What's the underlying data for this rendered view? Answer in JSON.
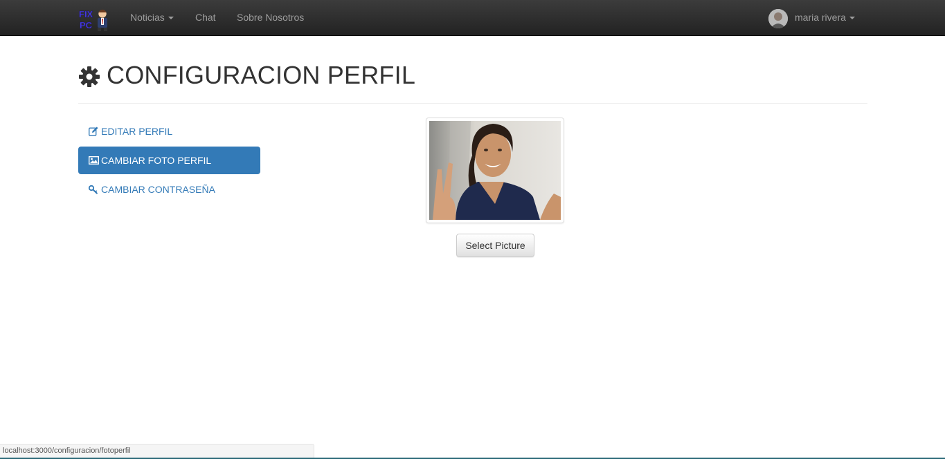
{
  "navbar": {
    "brand": {
      "logo_text_top": "FIX",
      "logo_text_bottom": "PC",
      "icon": "fixpc-logo-icon"
    },
    "items": [
      {
        "label": "Noticias",
        "has_dropdown": true
      },
      {
        "label": "Chat",
        "has_dropdown": false
      },
      {
        "label": "Sobre Nosotros",
        "has_dropdown": false
      }
    ],
    "user": {
      "name": "maria rivera",
      "has_dropdown": true,
      "avatar_icon": "user-avatar"
    }
  },
  "page": {
    "title": "CONFIGURACION PERFIL",
    "title_icon": "gear-icon"
  },
  "sidebar": {
    "items": [
      {
        "label": "EDITAR PERFIL",
        "icon": "edit-icon",
        "active": false
      },
      {
        "label": "CAMBIAR FOTO PERFIL",
        "icon": "picture-icon",
        "active": true
      },
      {
        "label": "CAMBIAR CONTRASEÑA",
        "icon": "key-icon",
        "active": false
      }
    ]
  },
  "profile_photo": {
    "button_label": "Select Picture"
  },
  "status_bar": {
    "url": "localhost:3000/configuracion/fotoperfil"
  },
  "colors": {
    "navbar_bg": "#222222",
    "nav_text": "#9d9d9d",
    "primary": "#337ab7",
    "active_text": "#ffffff"
  }
}
